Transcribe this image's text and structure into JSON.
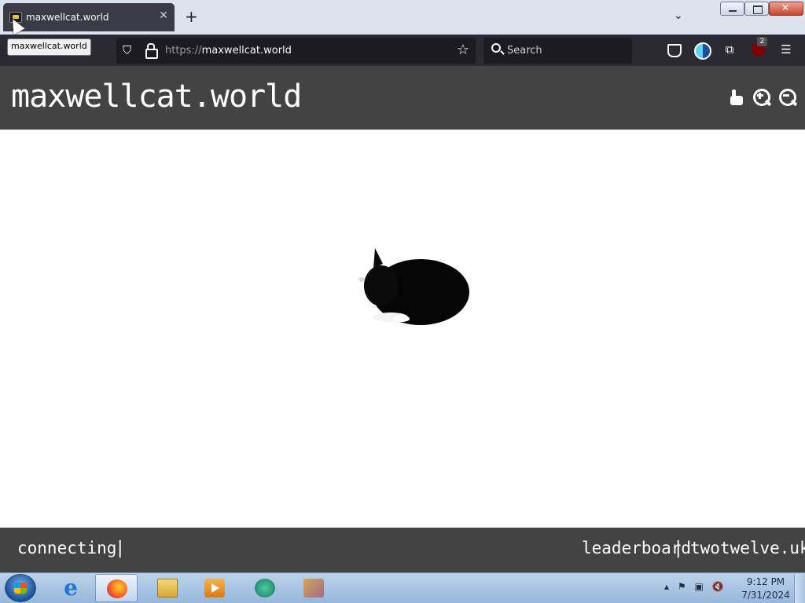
{
  "browser": {
    "tab": {
      "title": "maxwellcat.world",
      "close_glyph": "✕"
    },
    "new_tab_glyph": "+",
    "tab_list_glyph": "⌄",
    "tooltip": "maxwellcat.world",
    "url": {
      "protocol": "https://",
      "host": "maxwellcat.world"
    },
    "search_placeholder": "Search",
    "ublock_badge": "2",
    "icons": [
      "shield-icon",
      "lock-icon",
      "star-icon",
      "search-icon",
      "pocket-icon",
      "dark-reader-icon",
      "extensions-icon",
      "ublock-icon",
      "hamburger-menu-icon"
    ]
  },
  "site": {
    "title": "maxwellcat.world",
    "header_icons": [
      "hand-cursor-icon",
      "zoom-in-icon",
      "zoom-out-icon"
    ],
    "status": "connecting",
    "separator": "|",
    "footer_links": {
      "leaderboard": "leaderboard",
      "twotwelve": "twotwelve.uk"
    }
  },
  "taskbar": {
    "apps": [
      "internet-explorer",
      "firefox",
      "windows-explorer",
      "media-player",
      "chat-app",
      "photos-app"
    ],
    "active_app": "firefox",
    "clock": {
      "time": "9:12 PM",
      "date": "7/31/2024"
    },
    "tray_icons": [
      "show-hidden-icon",
      "action-center-flag-icon",
      "network-icon",
      "volume-muted-icon"
    ]
  },
  "colors": {
    "tab_active": "#3b3b45",
    "toolbar": "#2b2a33",
    "site_bar": "#434343",
    "canvas": "#ffffff"
  }
}
